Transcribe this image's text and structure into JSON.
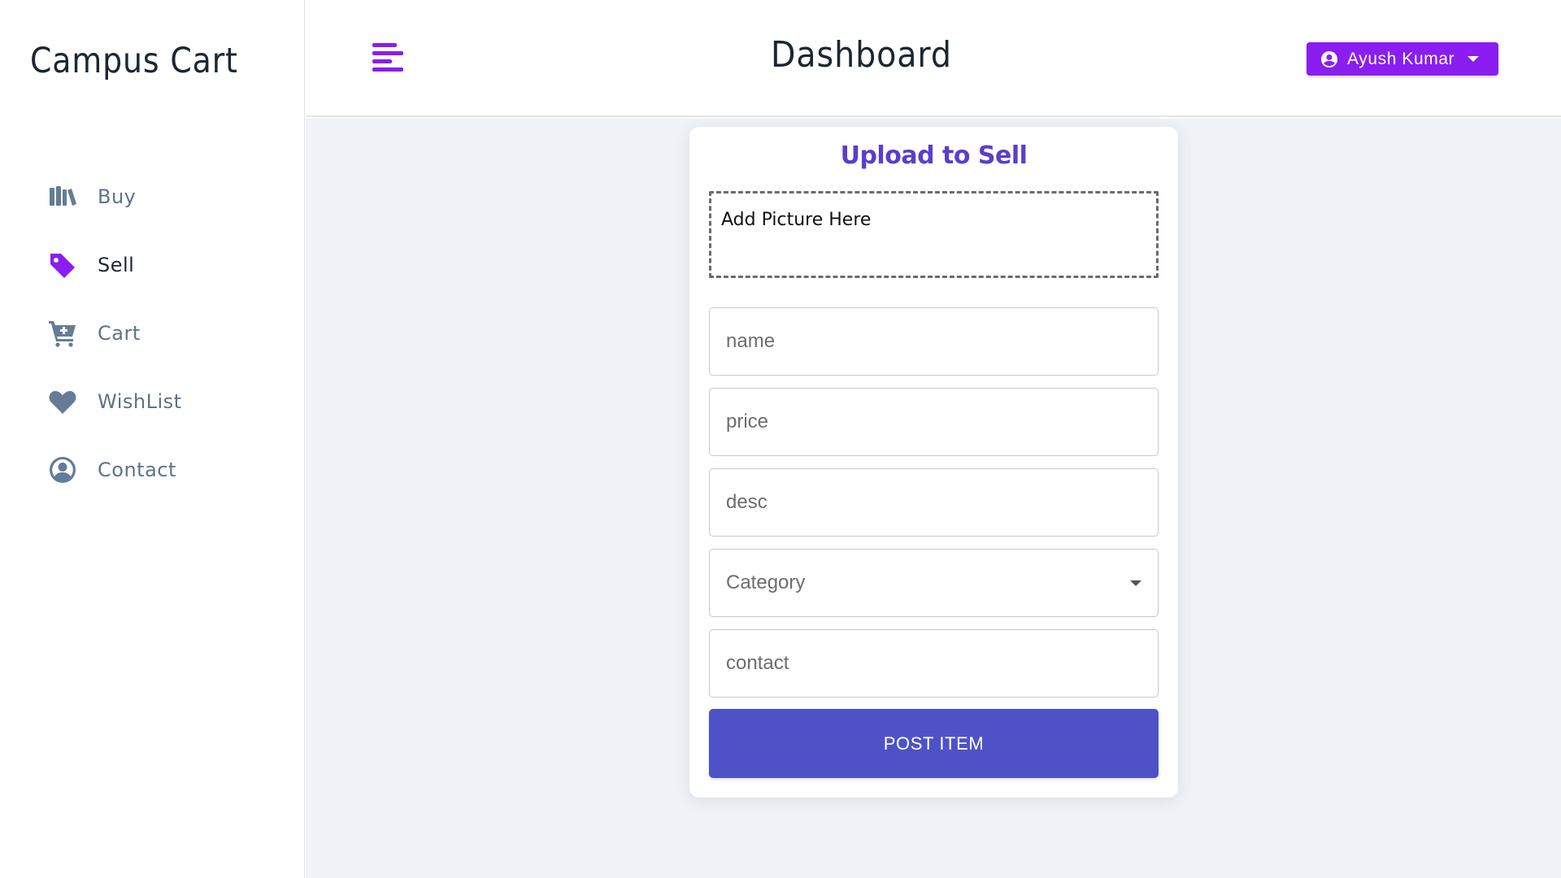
{
  "app": {
    "brand": "Campus Cart"
  },
  "colors": {
    "accent": "#8a1df0",
    "primary_button": "#4f52c7",
    "card_title": "#5a3ecb",
    "nav_icon": "#647c96",
    "main_bg": "#eff2f6"
  },
  "sidebar": {
    "items": [
      {
        "label": "Buy",
        "icon": "books-icon",
        "active": false
      },
      {
        "label": "Sell",
        "icon": "tag-icon",
        "active": true
      },
      {
        "label": "Cart",
        "icon": "cart-plus-icon",
        "active": false
      },
      {
        "label": "WishList",
        "icon": "heart-icon",
        "active": false
      },
      {
        "label": "Contact",
        "icon": "user-circle-icon",
        "active": false
      }
    ]
  },
  "header": {
    "title": "Dashboard",
    "menu_icon": "menu-icon",
    "user": {
      "name": "Ayush Kumar",
      "icon": "user-circle-icon"
    }
  },
  "form": {
    "title": "Upload to Sell",
    "picture_label": "Add Picture Here",
    "name_placeholder": "name",
    "price_placeholder": "price",
    "desc_placeholder": "desc",
    "category_label": "Category",
    "contact_placeholder": "contact",
    "submit_label": "POST ITEM"
  }
}
